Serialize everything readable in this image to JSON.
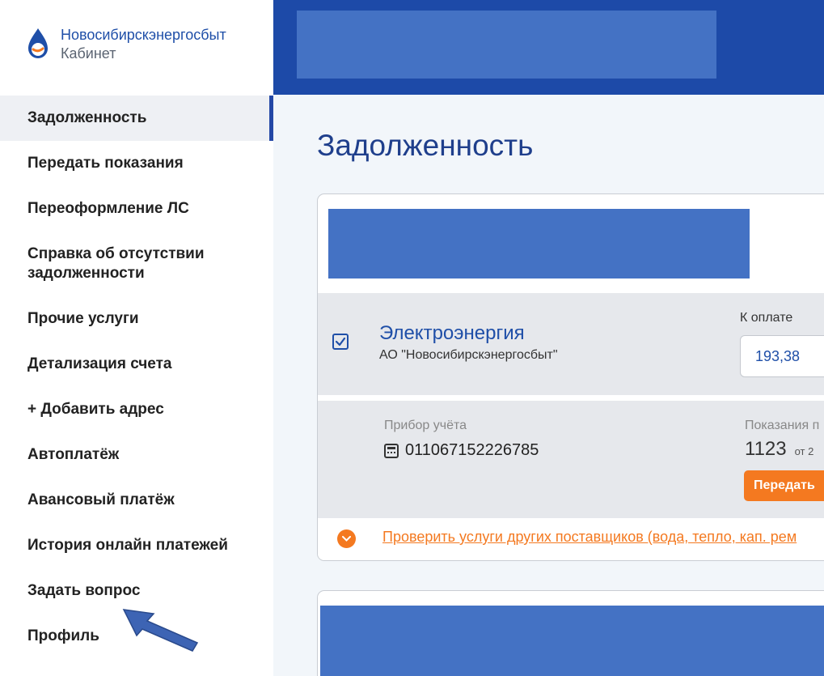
{
  "brand": {
    "name": "Новосибирскэнергосбыт",
    "subtitle": "Кабинет",
    "logo_icon": "drop-logo-icon"
  },
  "sidebar": {
    "items": [
      {
        "label": "Задолженность",
        "active": true
      },
      {
        "label": "Передать показания"
      },
      {
        "label": "Переоформление ЛС"
      },
      {
        "label": "Справка об отсутствии задолженности"
      },
      {
        "label": "Прочие услуги"
      },
      {
        "label": "Детализация счета"
      },
      {
        "label": "+ Добавить адрес"
      },
      {
        "label": "Автоплатёж"
      },
      {
        "label": "Авансовый платёж"
      },
      {
        "label": "История онлайн платежей"
      },
      {
        "label": "Задать вопрос"
      },
      {
        "label": "Профиль"
      }
    ]
  },
  "main": {
    "title": "Задолженность",
    "service": {
      "checked": true,
      "name": "Электроэнергия",
      "provider": "АО \"Новосибирскэнергосбыт\"",
      "pay_label": "К оплате",
      "pay_value": "193,38"
    },
    "meter": {
      "label": "Прибор учёта",
      "number": "011067152226785",
      "readings_label": "Показания п",
      "readings_value": "1123",
      "readings_date": "от 2",
      "submit_label": "Передать"
    },
    "check_link": "Проверить услуги других поставщиков (вода, тепло, кап. рем"
  },
  "colors": {
    "primary": "#1d4aa8",
    "accent": "#f47920",
    "redaction": "#4472c4"
  }
}
